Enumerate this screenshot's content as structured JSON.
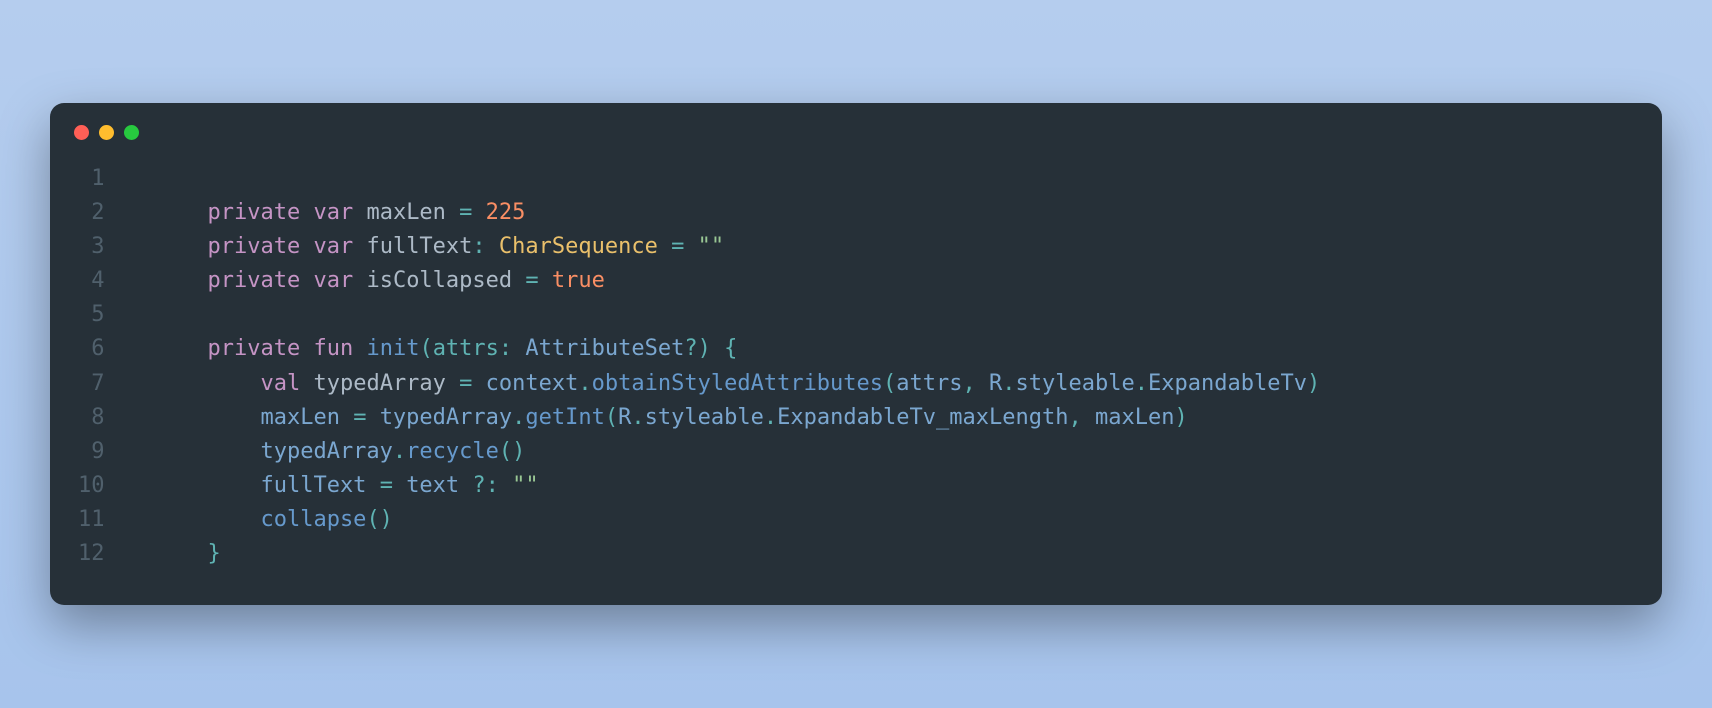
{
  "window": {
    "traffic_lights": [
      "red",
      "yellow",
      "green"
    ]
  },
  "code": {
    "lines": [
      {
        "n": "1",
        "tokens": []
      },
      {
        "n": "2",
        "tokens": [
          {
            "t": "    ",
            "c": "code"
          },
          {
            "t": "private",
            "c": "tok-keyword"
          },
          {
            "t": " ",
            "c": "code"
          },
          {
            "t": "var",
            "c": "tok-keyword"
          },
          {
            "t": " ",
            "c": "code"
          },
          {
            "t": "maxLen ",
            "c": "tok-ident"
          },
          {
            "t": "=",
            "c": "tok-punct"
          },
          {
            "t": " ",
            "c": "code"
          },
          {
            "t": "225",
            "c": "tok-number"
          }
        ]
      },
      {
        "n": "3",
        "tokens": [
          {
            "t": "    ",
            "c": "code"
          },
          {
            "t": "private",
            "c": "tok-keyword"
          },
          {
            "t": " ",
            "c": "code"
          },
          {
            "t": "var",
            "c": "tok-keyword"
          },
          {
            "t": " ",
            "c": "code"
          },
          {
            "t": "fullText",
            "c": "tok-ident"
          },
          {
            "t": ":",
            "c": "tok-punct"
          },
          {
            "t": " ",
            "c": "code"
          },
          {
            "t": "CharSequence",
            "c": "tok-type"
          },
          {
            "t": " ",
            "c": "code"
          },
          {
            "t": "=",
            "c": "tok-punct"
          },
          {
            "t": " ",
            "c": "code"
          },
          {
            "t": "\"\"",
            "c": "tok-string"
          }
        ]
      },
      {
        "n": "4",
        "tokens": [
          {
            "t": "    ",
            "c": "code"
          },
          {
            "t": "private",
            "c": "tok-keyword"
          },
          {
            "t": " ",
            "c": "code"
          },
          {
            "t": "var",
            "c": "tok-keyword"
          },
          {
            "t": " ",
            "c": "code"
          },
          {
            "t": "isCollapsed ",
            "c": "tok-ident"
          },
          {
            "t": "=",
            "c": "tok-punct"
          },
          {
            "t": " ",
            "c": "code"
          },
          {
            "t": "true",
            "c": "tok-bool"
          }
        ]
      },
      {
        "n": "5",
        "tokens": []
      },
      {
        "n": "6",
        "tokens": [
          {
            "t": "    ",
            "c": "code"
          },
          {
            "t": "private",
            "c": "tok-keyword"
          },
          {
            "t": " ",
            "c": "code"
          },
          {
            "t": "fun",
            "c": "tok-keyword"
          },
          {
            "t": " ",
            "c": "code"
          },
          {
            "t": "init",
            "c": "tok-funcname"
          },
          {
            "t": "(",
            "c": "tok-punct"
          },
          {
            "t": "attrs",
            "c": "tok-param"
          },
          {
            "t": ":",
            "c": "tok-punct"
          },
          {
            "t": " ",
            "c": "code"
          },
          {
            "t": "AttributeSet",
            "c": "tok-chain"
          },
          {
            "t": "?",
            "c": "tok-punct"
          },
          {
            "t": ")",
            "c": "tok-punct"
          },
          {
            "t": " ",
            "c": "code"
          },
          {
            "t": "{",
            "c": "tok-punct"
          }
        ]
      },
      {
        "n": "7",
        "tokens": [
          {
            "t": "        ",
            "c": "code"
          },
          {
            "t": "val",
            "c": "tok-keyword"
          },
          {
            "t": " ",
            "c": "code"
          },
          {
            "t": "typedArray ",
            "c": "tok-ident"
          },
          {
            "t": "=",
            "c": "tok-punct"
          },
          {
            "t": " ",
            "c": "code"
          },
          {
            "t": "context",
            "c": "tok-chain"
          },
          {
            "t": ".",
            "c": "tok-punct"
          },
          {
            "t": "obtainStyledAttributes",
            "c": "tok-func"
          },
          {
            "t": "(",
            "c": "tok-punct"
          },
          {
            "t": "attrs",
            "c": "tok-chain"
          },
          {
            "t": ",",
            "c": "tok-punct"
          },
          {
            "t": " ",
            "c": "code"
          },
          {
            "t": "R",
            "c": "tok-chain"
          },
          {
            "t": ".",
            "c": "tok-punct"
          },
          {
            "t": "styleable",
            "c": "tok-chain"
          },
          {
            "t": ".",
            "c": "tok-punct"
          },
          {
            "t": "ExpandableTv",
            "c": "tok-chain"
          },
          {
            "t": ")",
            "c": "tok-punct"
          }
        ]
      },
      {
        "n": "8",
        "tokens": [
          {
            "t": "        ",
            "c": "code"
          },
          {
            "t": "maxLen ",
            "c": "tok-chain"
          },
          {
            "t": "=",
            "c": "tok-punct"
          },
          {
            "t": " ",
            "c": "code"
          },
          {
            "t": "typedArray",
            "c": "tok-chain"
          },
          {
            "t": ".",
            "c": "tok-punct"
          },
          {
            "t": "getInt",
            "c": "tok-func"
          },
          {
            "t": "(",
            "c": "tok-punct"
          },
          {
            "t": "R",
            "c": "tok-chain"
          },
          {
            "t": ".",
            "c": "tok-punct"
          },
          {
            "t": "styleable",
            "c": "tok-chain"
          },
          {
            "t": ".",
            "c": "tok-punct"
          },
          {
            "t": "ExpandableTv_maxLength",
            "c": "tok-chain"
          },
          {
            "t": ",",
            "c": "tok-punct"
          },
          {
            "t": " ",
            "c": "code"
          },
          {
            "t": "maxLen",
            "c": "tok-chain"
          },
          {
            "t": ")",
            "c": "tok-punct"
          }
        ]
      },
      {
        "n": "9",
        "tokens": [
          {
            "t": "        ",
            "c": "code"
          },
          {
            "t": "typedArray",
            "c": "tok-chain"
          },
          {
            "t": ".",
            "c": "tok-punct"
          },
          {
            "t": "recycle",
            "c": "tok-func"
          },
          {
            "t": "()",
            "c": "tok-punct"
          }
        ]
      },
      {
        "n": "10",
        "tokens": [
          {
            "t": "        ",
            "c": "code"
          },
          {
            "t": "fullText ",
            "c": "tok-chain"
          },
          {
            "t": "=",
            "c": "tok-punct"
          },
          {
            "t": " ",
            "c": "code"
          },
          {
            "t": "text ",
            "c": "tok-chain"
          },
          {
            "t": "?:",
            "c": "tok-punct"
          },
          {
            "t": " ",
            "c": "code"
          },
          {
            "t": "\"\"",
            "c": "tok-string"
          }
        ]
      },
      {
        "n": "11",
        "tokens": [
          {
            "t": "        ",
            "c": "code"
          },
          {
            "t": "collapse",
            "c": "tok-func"
          },
          {
            "t": "()",
            "c": "tok-punct"
          }
        ]
      },
      {
        "n": "12",
        "tokens": [
          {
            "t": "    ",
            "c": "code"
          },
          {
            "t": "}",
            "c": "tok-punct"
          }
        ]
      }
    ]
  }
}
